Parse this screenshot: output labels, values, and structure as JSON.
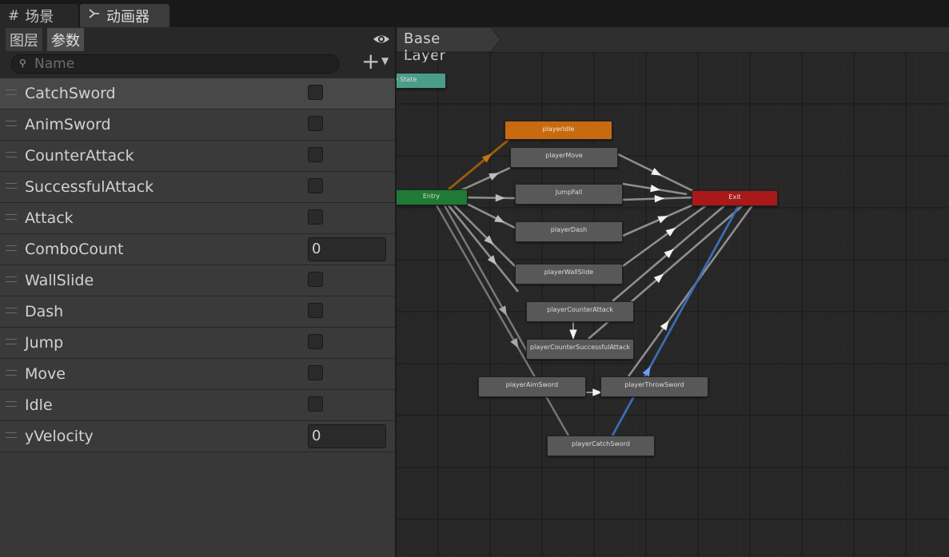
{
  "tabs": {
    "scene": {
      "icon": "grid-icon",
      "label": "场景"
    },
    "animator": {
      "icon": "animator-icon",
      "label": "动画器"
    }
  },
  "left_panel": {
    "subtabs": {
      "layers": "图层",
      "parameters": "参数"
    },
    "search": {
      "placeholder": "Name",
      "value": ""
    },
    "parameters": [
      {
        "name": "CatchSword",
        "type": "bool",
        "value": false
      },
      {
        "name": "AnimSword",
        "type": "bool",
        "value": false
      },
      {
        "name": "CounterAttack",
        "type": "bool",
        "value": false
      },
      {
        "name": "SuccessfulAttack",
        "type": "bool",
        "value": false
      },
      {
        "name": "Attack",
        "type": "bool",
        "value": false
      },
      {
        "name": "ComboCount",
        "type": "int",
        "value": "0"
      },
      {
        "name": "WallSlide",
        "type": "bool",
        "value": false
      },
      {
        "name": "Dash",
        "type": "bool",
        "value": false
      },
      {
        "name": "Jump",
        "type": "bool",
        "value": false
      },
      {
        "name": "Move",
        "type": "bool",
        "value": false
      },
      {
        "name": "Idle",
        "type": "bool",
        "value": false
      },
      {
        "name": "yVelocity",
        "type": "int",
        "value": "0"
      }
    ]
  },
  "graph": {
    "breadcrumb": "Base Layer",
    "colors": {
      "orange": "#c86a10",
      "green": "#1e7a34",
      "red": "#a81919",
      "teal": "#4a9d8a",
      "gray": "#585858",
      "transition": "#8e8e8e",
      "selected": "#3b6db5"
    },
    "nodes": {
      "any_state": "y State",
      "entry": "Entry",
      "exit": "Exit",
      "player_idle": "playerIdle",
      "player_move": "playerMove",
      "jump_fall": "JumpFall",
      "player_dash": "playerDash",
      "player_wall_slide": "playerWallSlide",
      "player_counter_attack": "playerCounterAttack",
      "player_counter_successful_attack": "playerCounterSuccessfulAttack",
      "player_aim_sword": "playerAimSword",
      "player_throw_sword": "playerThrowSword",
      "player_catch_sword": "playerCatchSword"
    }
  }
}
